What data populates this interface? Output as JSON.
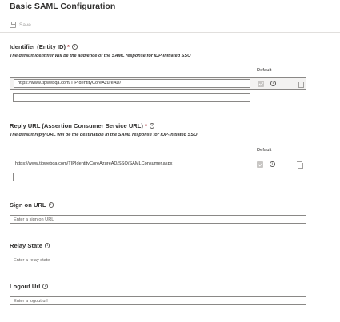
{
  "header": {
    "title": "Basic SAML Configuration"
  },
  "toolbar": {
    "save_label": "Save"
  },
  "identifier": {
    "label": "Identifier (Entity ID)",
    "required": "*",
    "description": "The default identifier will be the audience of the SAML response for IDP-initiated SSO",
    "default_label": "Default",
    "value": "https://www.tipwebqa.com/TIPIdentityCoreAzureAD/"
  },
  "reply_url": {
    "label": "Reply URL (Assertion Consumer Service URL)",
    "required": "*",
    "description": "The default reply URL will be the destination in the SAML response for IDP-initiated SSO",
    "default_label": "Default",
    "value": "https://www.tipwebqa.com/TIPIdentityCoreAzureAD/SSO/SAMLConsumer.aspx"
  },
  "sign_on": {
    "label": "Sign on URL",
    "placeholder": "Enter a sign on URL"
  },
  "relay_state": {
    "label": "Relay State",
    "placeholder": "Enter a relay state"
  },
  "logout": {
    "label": "Logout Url",
    "placeholder": "Enter a logout url"
  },
  "icons": {
    "info": "i"
  }
}
